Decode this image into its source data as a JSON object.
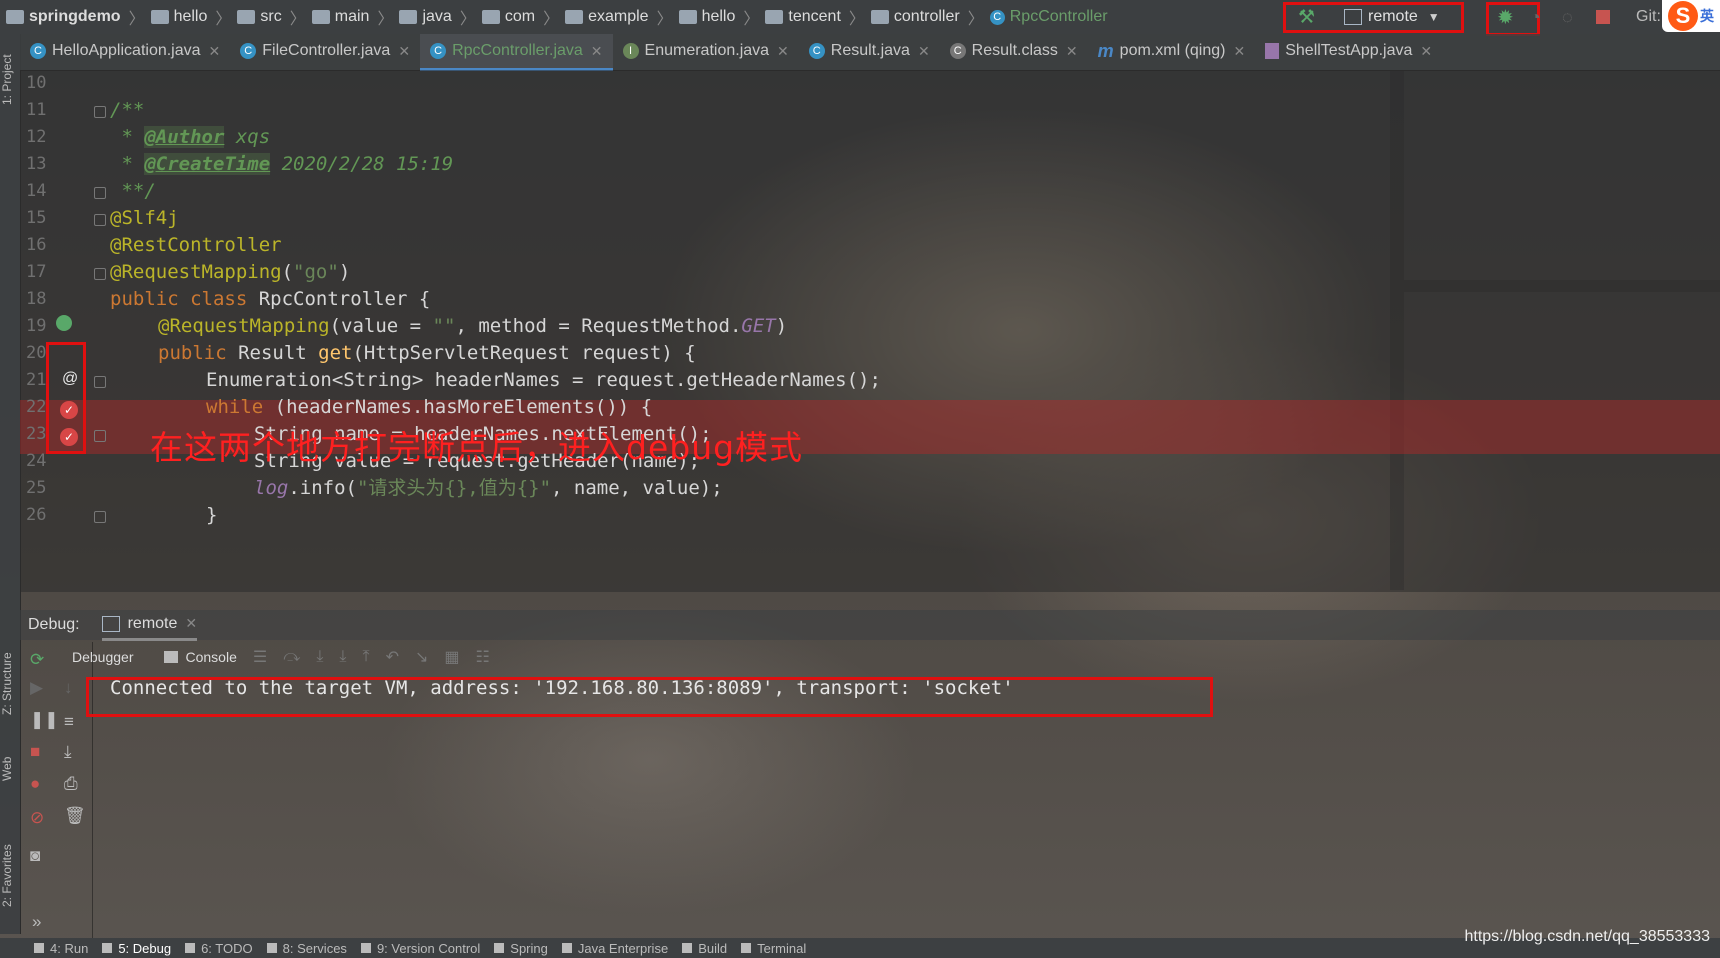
{
  "breadcrumbs": [
    {
      "label": "springdemo",
      "type": "project"
    },
    {
      "label": "hello",
      "type": "folder"
    },
    {
      "label": "src",
      "type": "folder"
    },
    {
      "label": "main",
      "type": "folder"
    },
    {
      "label": "java",
      "type": "folder"
    },
    {
      "label": "com",
      "type": "folder"
    },
    {
      "label": "example",
      "type": "folder"
    },
    {
      "label": "hello",
      "type": "folder"
    },
    {
      "label": "tencent",
      "type": "folder"
    },
    {
      "label": "controller",
      "type": "folder"
    },
    {
      "label": "RpcController",
      "type": "class"
    }
  ],
  "toolbar": {
    "run_config": "remote",
    "git_label": "Git:",
    "ime_label": "英"
  },
  "tabs": [
    {
      "label": "HelloApplication.java",
      "icon": "c-class-icon"
    },
    {
      "label": "FileController.java",
      "icon": "c-class-icon"
    },
    {
      "label": "RpcController.java",
      "icon": "c-class-icon",
      "active": true
    },
    {
      "label": "Enumeration.java",
      "icon": "interface-icon"
    },
    {
      "label": "Result.java",
      "icon": "c-class-icon"
    },
    {
      "label": "Result.class",
      "icon": "compiled-class-icon"
    },
    {
      "label": "pom.xml (qing)",
      "icon": "maven-icon"
    },
    {
      "label": "ShellTestApp.java",
      "icon": "shell-icon"
    }
  ],
  "left_strip": {
    "project": "1: Project",
    "structure": "Z: Structure",
    "web": "Web",
    "favorites": "2: Favorites"
  },
  "editor": {
    "line_numbers": [
      "10",
      "11",
      "12",
      "13",
      "14",
      "15",
      "16",
      "17",
      "18",
      "19",
      "20",
      "21",
      "22",
      "23",
      "24",
      "25",
      "26"
    ],
    "lines": {
      "l11": "/**",
      "l12_star": " * ",
      "l12_tag": "@Author",
      "l12_text": " xqs",
      "l13_star": " * ",
      "l13_tag": "@CreateTime",
      "l13_text": " 2020/2/28 15:19",
      "l14": " **/",
      "l15": "@Slf4j",
      "l16": "@RestController",
      "l17_ann": "@RequestMapping",
      "l17_open": "(",
      "l17_str": "\"go\"",
      "l17_close": ")",
      "l18_kw": "public class",
      "l18_rest": " RpcController {",
      "l19_ann": "@RequestMapping",
      "l19_a": "(value = ",
      "l19_str": "\"\"",
      "l19_b": ", method = RequestMethod.",
      "l19_fld": "GET",
      "l19_c": ")",
      "l20_kw": "public",
      "l20_a": " Result ",
      "l20_fn": "get",
      "l20_b": "(HttpServletRequest request) {",
      "l21": "Enumeration<String> headerNames = request.getHeaderNames();",
      "l22_kw": "while",
      "l22_rest": " (headerNames.hasMoreElements()) {",
      "l23": "String name = headerNames.nextElement();",
      "l24": "String value = request.getHeader(name);",
      "l25_fld": "log",
      "l25_a": ".info(",
      "l25_str": "\"请求头为{},值为{}\"",
      "l25_b": ", name, value);",
      "l26": "}"
    },
    "annotation_text": "在这两个地方打完断点后，进入debug模式"
  },
  "debug": {
    "label": "Debug:",
    "session_tab": "remote",
    "debugger_tab": "Debugger",
    "console_tab": "Console",
    "console_output": "Connected to the target VM, address: '192.168.80.136:8089', transport: 'socket'"
  },
  "statusbar": {
    "items": [
      "4: Run",
      "5: Debug",
      "6: TODO",
      "8: Services",
      "9: Version Control",
      "Spring",
      "Java Enterprise",
      "Build",
      "Terminal"
    ],
    "watermark": "https://blog.csdn.net/qq_38553333"
  },
  "colors": {
    "accent_red": "#e01010",
    "keyword": "#cc7832",
    "annotation": "#bbb529",
    "string": "#6a8759",
    "doc": "#629755",
    "function": "#ffc66d"
  }
}
